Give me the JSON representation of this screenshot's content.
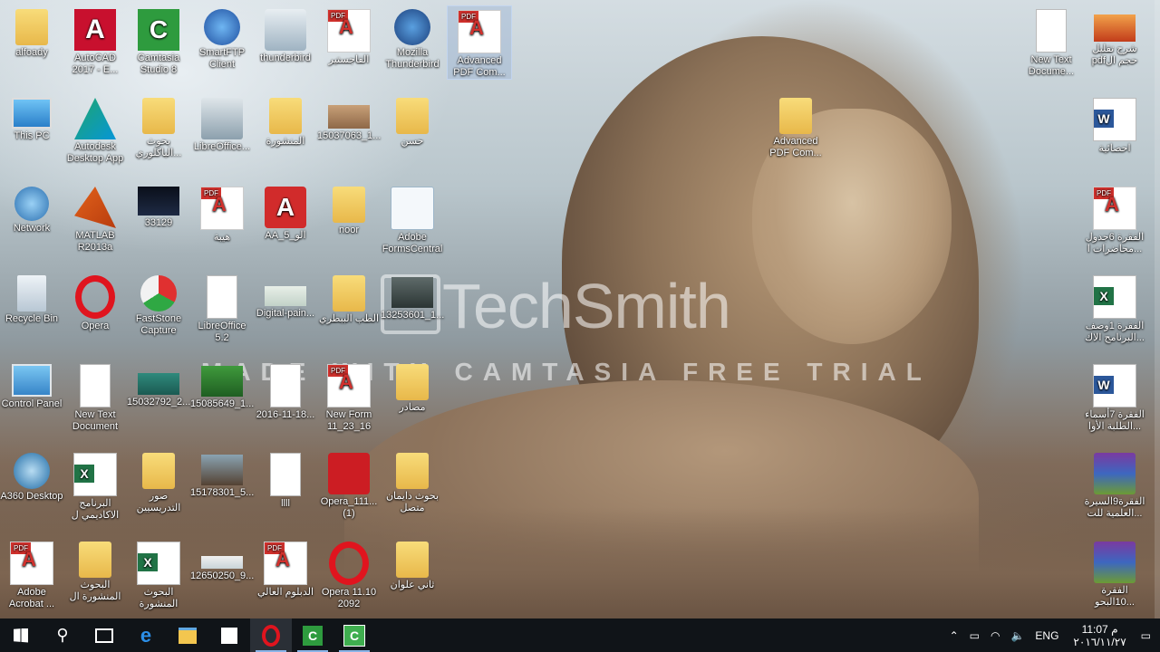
{
  "watermark": {
    "brand": "TechSmith",
    "trial_text": "MADE WITH CAMTASIA FREE TRIAL"
  },
  "desktop_icons": [
    {
      "label": "alfoady",
      "glyph": "user-folder-icon"
    },
    {
      "label": "AutoCAD 2017 - E...",
      "glyph": "autocad-icon"
    },
    {
      "label": "Camtasia Studio 8",
      "glyph": "camtasia-icon"
    },
    {
      "label": "SmartFTP Client",
      "glyph": "smartftp-icon"
    },
    {
      "label": "thunderbird",
      "glyph": "installer-icon"
    },
    {
      "label": "الفاجستير",
      "glyph": "pdf-icon"
    },
    {
      "label": "Mozilla Thunderbird",
      "glyph": "thunderbird-icon"
    },
    {
      "label": "Advanced PDF Com...",
      "glyph": "advanced-pdf-icon"
    },
    {
      "label": "This PC",
      "glyph": "computer-icon"
    },
    {
      "label": "Autodesk Desktop App",
      "glyph": "autodesk-icon"
    },
    {
      "label": "بحوث الباكلوري...",
      "glyph": "pdf-folder-icon"
    },
    {
      "label": "LibreOffice...",
      "glyph": "libreoffice-installer-icon"
    },
    {
      "label": "المنشورة",
      "glyph": "folder-icon"
    },
    {
      "label": "15037063_1...",
      "glyph": "image-icon"
    },
    {
      "label": "حسن",
      "glyph": "folder-icon"
    },
    {
      "label": "Network",
      "glyph": "network-icon"
    },
    {
      "label": "MATLAB R2013a",
      "glyph": "matlab-icon"
    },
    {
      "label": "33129",
      "glyph": "video-icon"
    },
    {
      "label": "هيبة",
      "glyph": "pdf-icon"
    },
    {
      "label": "AA_الو_5",
      "glyph": "autocad-file-icon"
    },
    {
      "label": "noor",
      "glyph": "folder-icon"
    },
    {
      "label": "Adobe FormsCentral",
      "glyph": "formscentral-icon"
    },
    {
      "label": "Recycle Bin",
      "glyph": "recycle-bin-icon"
    },
    {
      "label": "Opera",
      "glyph": "opera-icon"
    },
    {
      "label": "FastStone Capture",
      "glyph": "faststone-icon"
    },
    {
      "label": "LibreOffice 5.2",
      "glyph": "document-icon"
    },
    {
      "label": "Digital-pain...",
      "glyph": "image-icon"
    },
    {
      "label": "الطب الببطري",
      "glyph": "folder-icon"
    },
    {
      "label": "13253601_1...",
      "glyph": "image-icon"
    },
    {
      "label": "Control Panel",
      "glyph": "control-panel-icon"
    },
    {
      "label": "New Text Document",
      "glyph": "text-document-icon"
    },
    {
      "label": "15032792_2...",
      "glyph": "image-icon"
    },
    {
      "label": "15085649_1...",
      "glyph": "image-icon"
    },
    {
      "label": "2016-11-18...",
      "glyph": "document-icon"
    },
    {
      "label": "New Form 11_23_16",
      "glyph": "pdf-icon"
    },
    {
      "label": "مصادر",
      "glyph": "word-folder-icon"
    },
    {
      "label": "A360 Desktop",
      "glyph": "a360-icon"
    },
    {
      "label": "البرنامج الاكاديمي ل",
      "glyph": "excel-icon"
    },
    {
      "label": "صور التدريسيين",
      "glyph": "image-folder-icon"
    },
    {
      "label": "15178301_5...",
      "glyph": "image-icon"
    },
    {
      "label": "llll",
      "glyph": "document-icon"
    },
    {
      "label": "Opera_111... (1)",
      "glyph": "opera-installer-icon"
    },
    {
      "label": "بحوث دايمان متصل",
      "glyph": "pdf-folder-icon"
    },
    {
      "label": "Adobe Acrobat ...",
      "glyph": "acrobat-icon"
    },
    {
      "label": "البحوث المنشورة ال",
      "glyph": "pdf-folder-icon"
    },
    {
      "label": "البحوث المنشورة",
      "glyph": "excel-icon"
    },
    {
      "label": "12650250_9...",
      "glyph": "image-icon"
    },
    {
      "label": "الدبلوم العالي",
      "glyph": "pdf-icon"
    },
    {
      "label": "Opera 11.10 2092",
      "glyph": "opera-icon"
    },
    {
      "label": "ثاني علوان",
      "glyph": "word-folder-icon"
    },
    {
      "label": "Advanced PDF Com...",
      "glyph": "folder-icon"
    },
    {
      "label": "New Text Docume...",
      "glyph": "text-document-icon"
    },
    {
      "label": "شرح تقليل pdfحجم ال",
      "glyph": "image-icon"
    },
    {
      "label": "احصائية",
      "glyph": "word-icon"
    },
    {
      "label": "الفقرة 6جدول محاضرات ا...",
      "glyph": "pdf-icon"
    },
    {
      "label": "الفقرة 1وصف البرنامج الاك...",
      "glyph": "excel-icon"
    },
    {
      "label": "الفقرة 7أسماء الطلبة الأوا...",
      "glyph": "word-icon"
    },
    {
      "label": "الفقرة9السيرة العلمية للت...",
      "glyph": "winrar-icon"
    },
    {
      "label": "الفقرة 10البحو...",
      "glyph": "winrar-icon"
    }
  ],
  "taskbar": {
    "start": "start-icon",
    "search": "search-icon",
    "task_view": "task-view-icon",
    "apps": [
      "edge-icon",
      "file-explorer-icon",
      "store-icon",
      "opera-icon",
      "camtasia-icon",
      "camtasia-recorder-icon"
    ],
    "language": "ENG",
    "time": "11:07 م",
    "date": "٢٠١٦/١١/٢٧"
  }
}
